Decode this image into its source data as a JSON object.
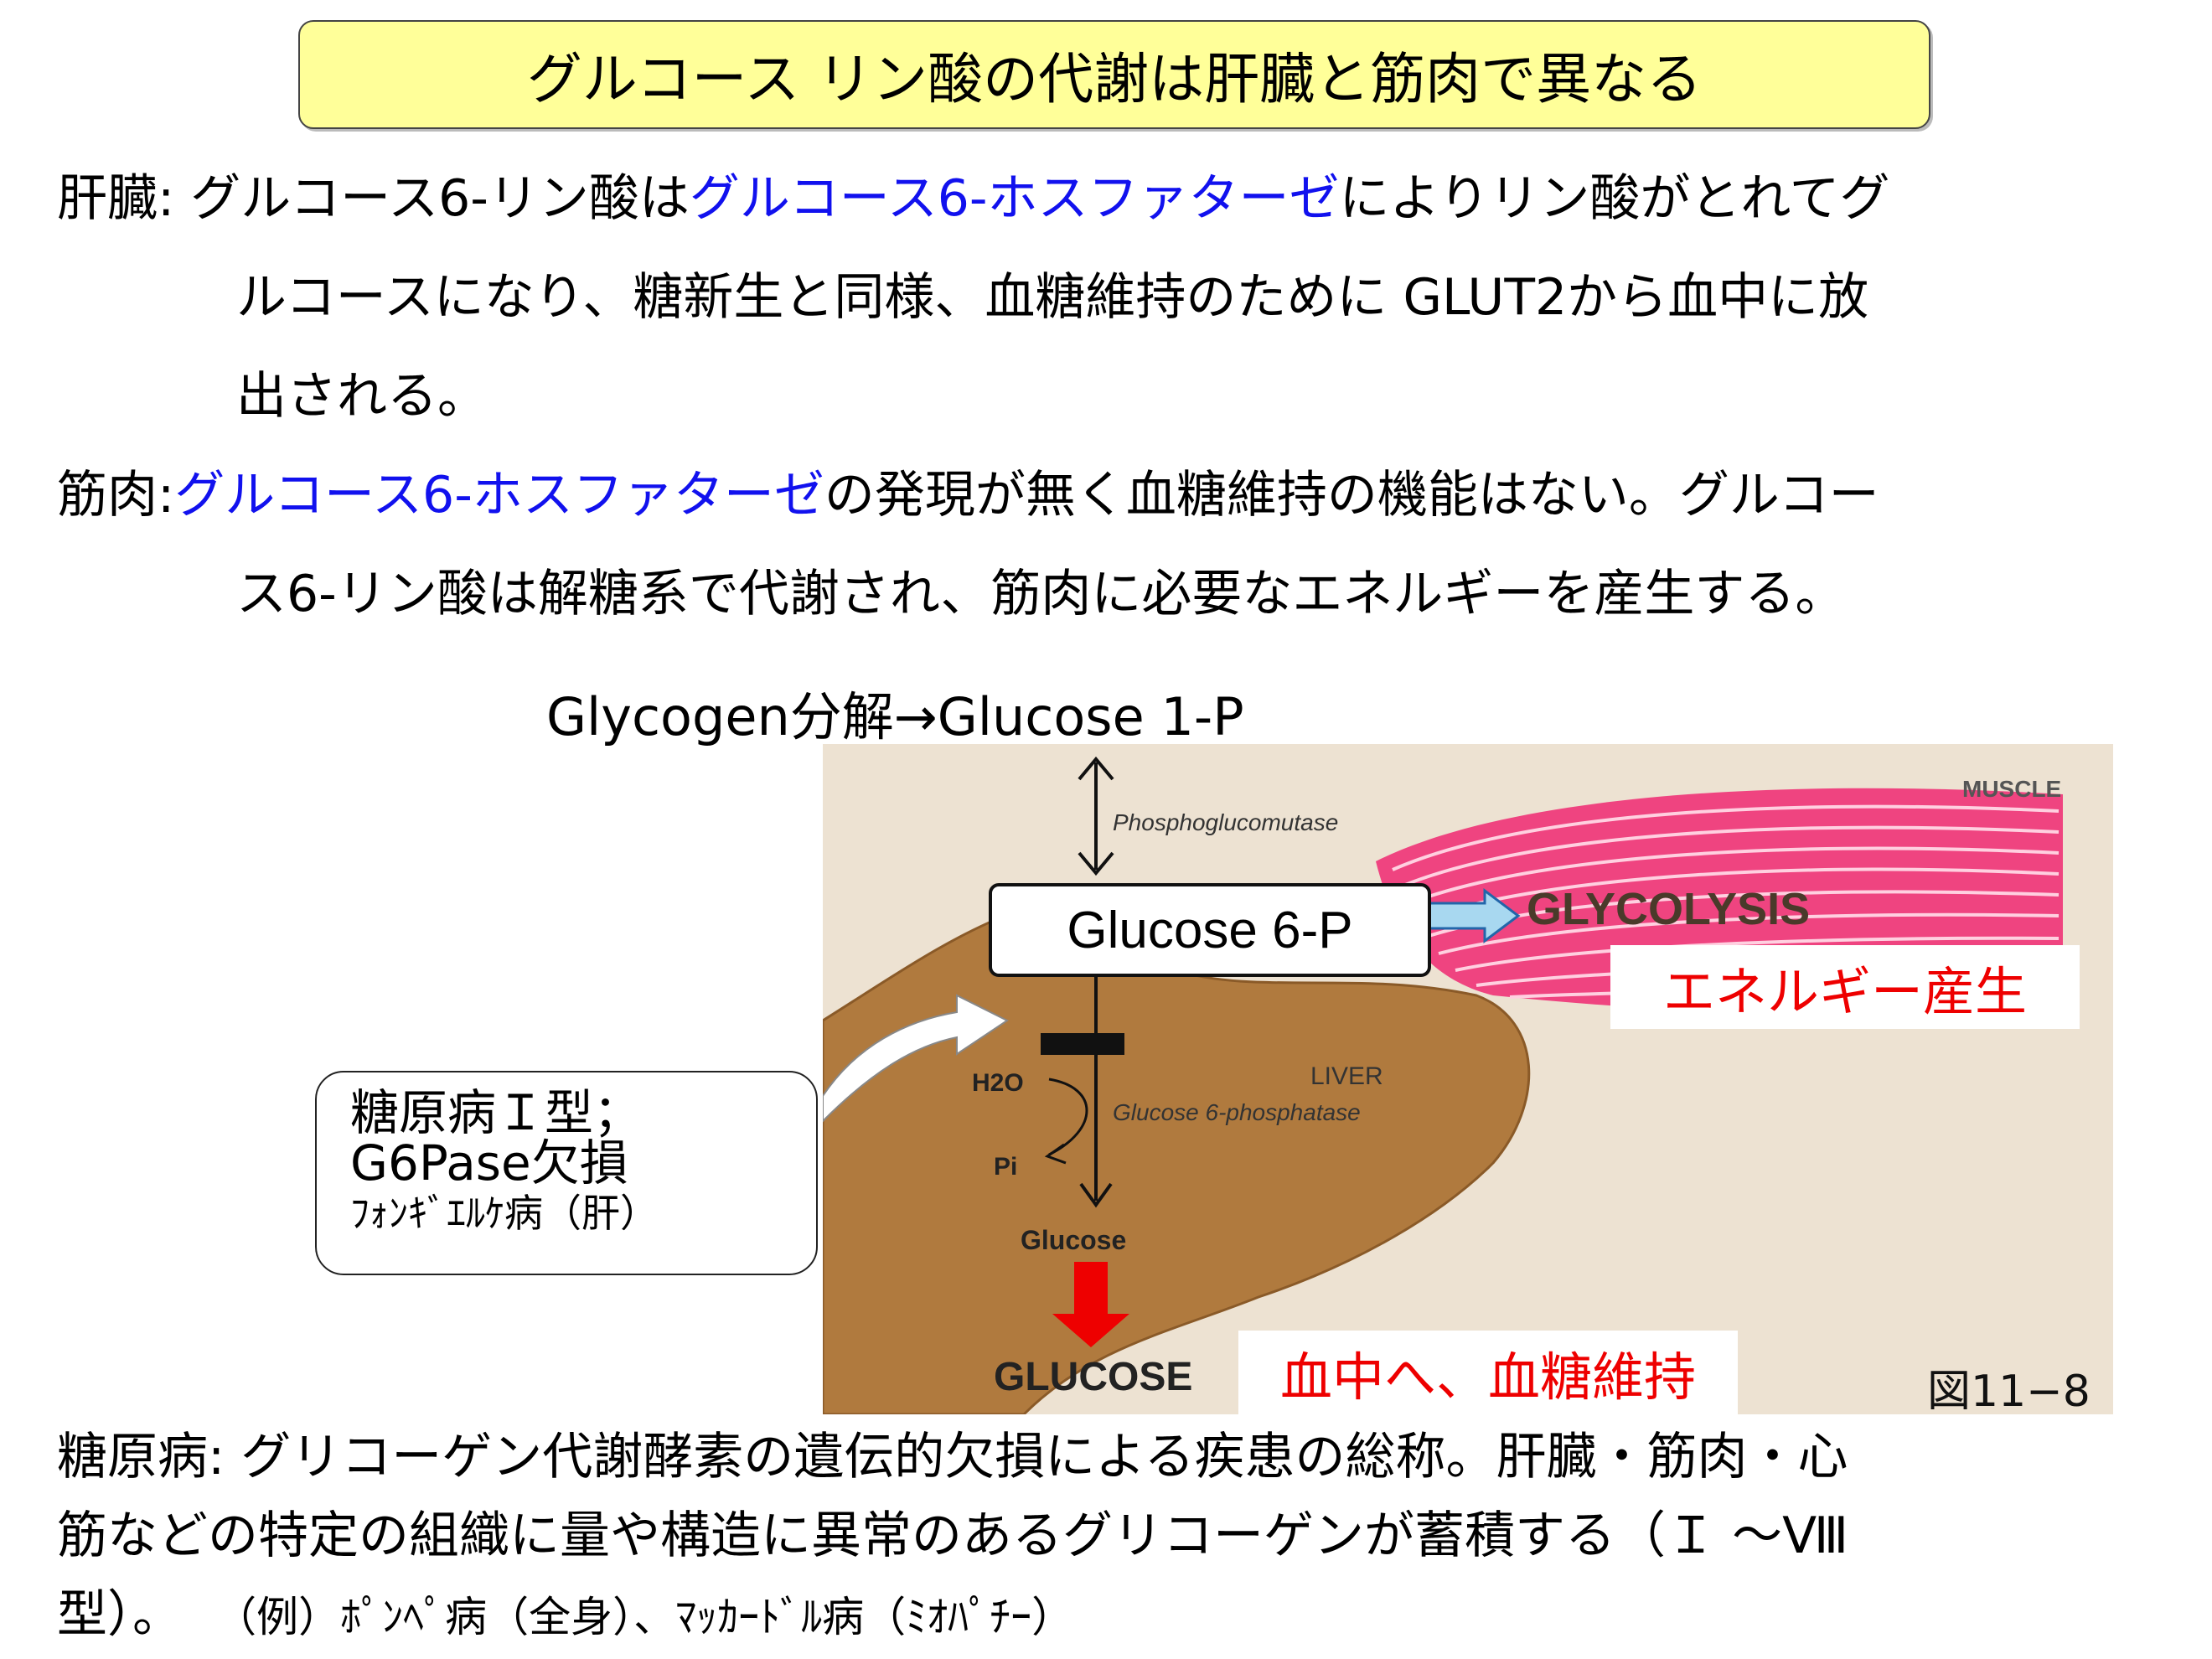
{
  "title": "グルコース リン酸の代謝は肝臓と筋肉で異なる",
  "liver": {
    "label": "肝臓",
    "sep": ":",
    "line1_a": "グルコース6-リン酸は",
    "line1_b": "グルコース6-ホスファターゼ",
    "line1_c": "によりリン酸がとれてグ",
    "line2": "ルコースになり、糖新生と同様、血糖維持のために GLUT2から血中に放",
    "line3": "出される。"
  },
  "muscle": {
    "label": "筋肉",
    "sep": ":",
    "line1_b": "グルコース6-ホスファターゼ",
    "line1_c": "の発現が無く血糖維持の機能はない。グルコー",
    "line2": "ス6-リン酸は解糖系で代謝され、筋肉に必要なエネルギーを産生する。"
  },
  "figure": {
    "glycogen_line": "Glycogen分解→Glucose 1-P",
    "phosphoglucomutase": "Phosphoglucomutase",
    "muscle_label": "MUSCLE",
    "glucose6p": "Glucose 6-P",
    "glycolysis": "GLYCOLYSIS",
    "energy": "エネルギー産生",
    "h2o": "H2O",
    "pi": "Pi",
    "liver_label": "LIVER",
    "g6phosphatase": "Glucose 6-phosphatase",
    "glucose_small": "Glucose",
    "glucose_big": "GLUCOSE",
    "blood": "血中へ、血糖維持",
    "fig_number": "図11−8",
    "colors": {
      "muscle": "#ee3377",
      "liver": "#b07a3e",
      "arrow_red": "#ee0000",
      "arrow_blue": "#a8d8f0"
    }
  },
  "callout": {
    "line1": "糖原病Ｉ型；",
    "line2": "G6Pase欠損",
    "line3": "ﾌｫﾝｷﾞｴﾙｹ病（肝）"
  },
  "bottom": {
    "line1": "糖原病: グリコーゲン代謝酵素の遺伝的欠損による疾患の総称。肝臓・筋肉・心",
    "line2": "筋などの特定の組織に量や構造に異常のあるグリコーゲンが蓄積する（Ｉ ～Ⅷ",
    "line3_a": "型）。",
    "line3_b": "（例）ﾎﾟﾝﾍﾟ病（全身）、ﾏｯｶｰﾄﾞﾙ病（ﾐｵﾊﾟﾁｰ）"
  }
}
